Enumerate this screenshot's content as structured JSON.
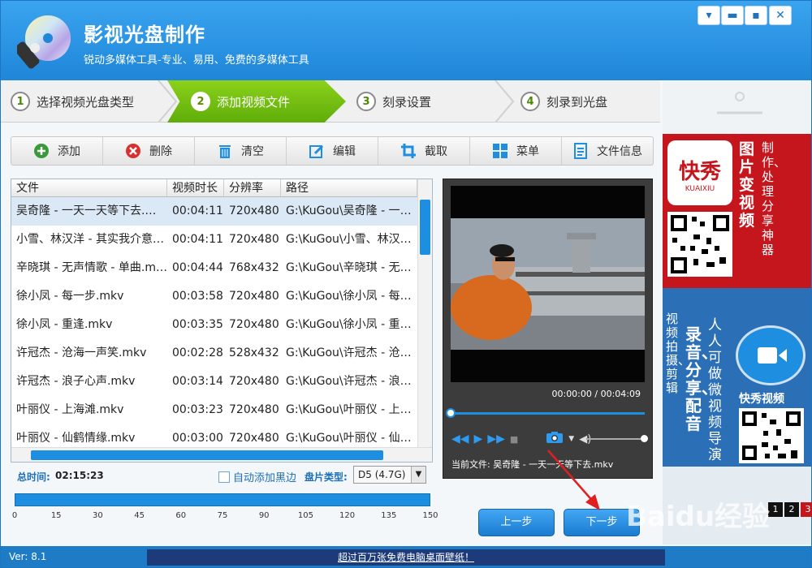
{
  "app": {
    "title": "影视光盘制作",
    "subtitle": "锐动多媒体工具-专业、易用、免费的多媒体工具",
    "version": "Ver: 8.1"
  },
  "steps": [
    {
      "num": "1",
      "label": "选择视频光盘类型"
    },
    {
      "num": "2",
      "label": "添加视频文件"
    },
    {
      "num": "3",
      "label": "刻录设置"
    },
    {
      "num": "4",
      "label": "刻录到光盘"
    }
  ],
  "toolbar": {
    "add": "添加",
    "delete": "删除",
    "clear": "清空",
    "edit": "编辑",
    "crop": "截取",
    "menu": "菜单",
    "info": "文件信息"
  },
  "table": {
    "headers": [
      "文件",
      "视频时长",
      "分辨率",
      "路径"
    ],
    "rows": [
      [
        "吴奇隆 - 一天一天等下去.mkv",
        "00:04:11",
        "720x480",
        "G:\\KuGou\\吴奇隆 - 一天一天等下去.mkv"
      ],
      [
        "小雪、林汉洋 - 其实我介意.mkv",
        "00:04:11",
        "720x480",
        "G:\\KuGou\\小雪、林汉洋 - 其实我介意.mkv"
      ],
      [
        "辛晓琪 - 无声情歌 - 单曲.mkv",
        "00:04:44",
        "768x432",
        "G:\\KuGou\\辛晓琪 - 无声情歌.mkv"
      ],
      [
        "徐小凤 - 每一步.mkv",
        "00:03:58",
        "720x480",
        "G:\\KuGou\\徐小凤 - 每一步.mkv"
      ],
      [
        "徐小凤 - 重逢.mkv",
        "00:03:35",
        "720x480",
        "G:\\KuGou\\徐小凤 - 重逢.mkv"
      ],
      [
        "许冠杰 - 沧海一声笑.mkv",
        "00:02:28",
        "528x432",
        "G:\\KuGou\\许冠杰 - 沧海一声笑.mkv"
      ],
      [
        "许冠杰 - 浪子心声.mkv",
        "00:03:14",
        "720x480",
        "G:\\KuGou\\许冠杰 - 浪子心声.mkv"
      ],
      [
        "叶丽仪 - 上海滩.mkv",
        "00:03:23",
        "720x480",
        "G:\\KuGou\\叶丽仪 - 上海滩.mkv"
      ],
      [
        "叶丽仪 - 仙鹤情缘.mkv",
        "00:03:00",
        "720x480",
        "G:\\KuGou\\叶丽仪 - 仙鹤情缘.mkv"
      ]
    ]
  },
  "stats": {
    "total_label": "总时间:",
    "total_value": "02:15:23",
    "auto_black": "自动添加黑边",
    "disc_label": "盘片类型:",
    "disc_value": "D5 (4.7G)"
  },
  "capacity": {
    "ticks": [
      "0",
      "15",
      "30",
      "45",
      "60",
      "75",
      "90",
      "105",
      "120",
      "135",
      "150"
    ],
    "fill_fraction": 1.0
  },
  "player": {
    "timecode": "00:00:00 / 00:04:09",
    "current_file": "当前文件: 吴奇隆 - 一天一天等下去.mkv"
  },
  "nav": {
    "prev": "上一步",
    "next": "下一步"
  },
  "ad": {
    "brand": "快秀",
    "brand_en": "KUAIXIU",
    "slogan1": "图片变视频",
    "slogan2": "制作、处理分享神器",
    "slogan3": "视频拍摄、剪辑",
    "slogan4": "录音、分享、配音",
    "slogan5": "人人可做微视频导演",
    "app_name": "快秀视频",
    "pages": [
      "1",
      "2",
      "3"
    ]
  },
  "footer": {
    "link": "超过百万张免费电脑桌面壁纸！"
  },
  "watermark": "Baidu经验",
  "colors": {
    "accent": "#1e8ee0",
    "active_step": "#6cbb0f",
    "delete_red": "#d93030",
    "add_green": "#3a9a3a"
  }
}
